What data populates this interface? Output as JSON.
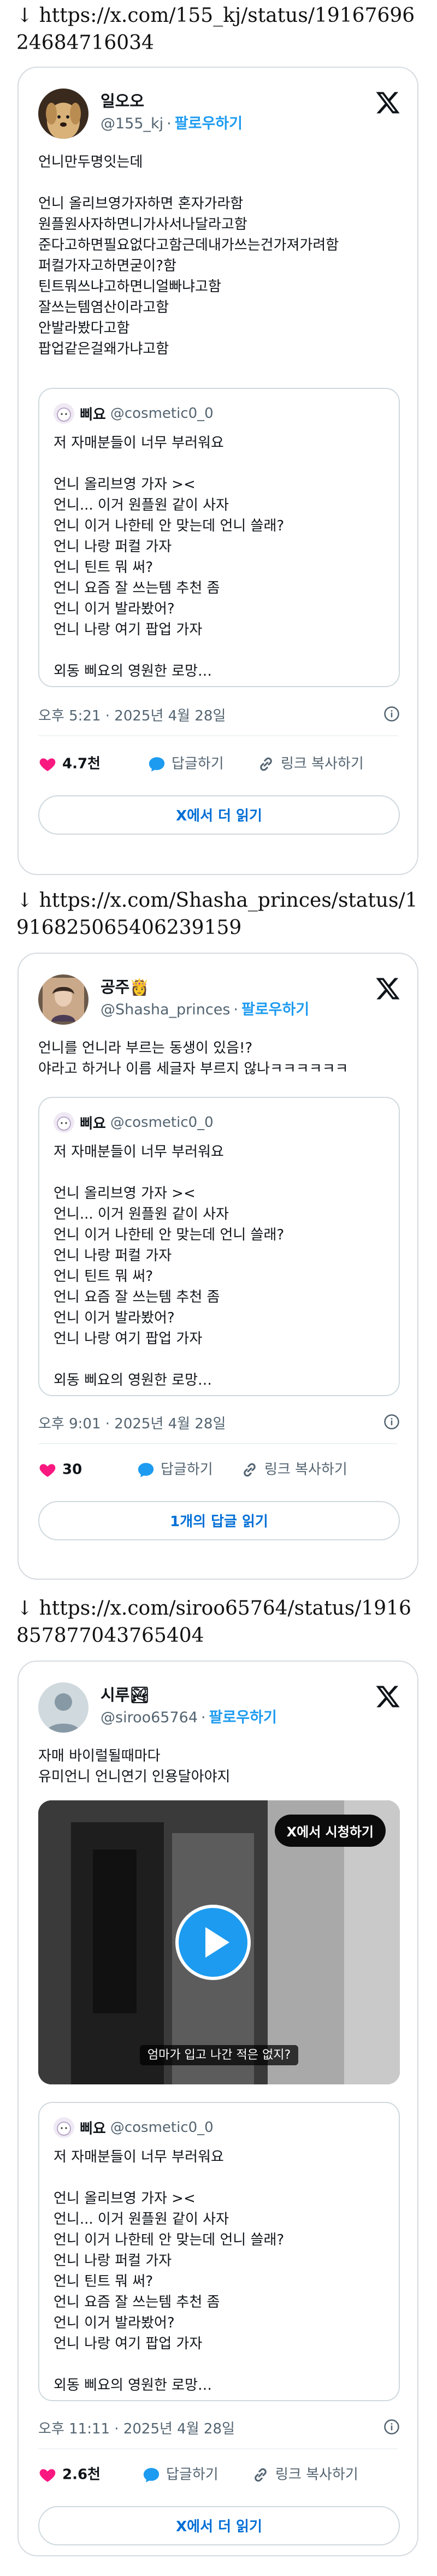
{
  "colors": {
    "link_blue": "#1d9bf0",
    "readmore_blue": "#006fd6",
    "heart": "#f91880",
    "muted": "#536471",
    "border": "#cfd9de"
  },
  "common": {
    "follow_label": "팔로우하기",
    "dot": "·",
    "reply_label": "답글하기",
    "copy_link_label": "링크 복사하기",
    "read_more_label": "X에서 더 읽기",
    "quote": {
      "name": "삐요",
      "handle": "@cosmetic0_0",
      "lines": [
        "저 자매분들이 너무 부러워요",
        "",
        "언니 올리브영 가자 ><",
        "언니... 이거 원플원 같이 사자",
        "언니 이거 나한테 안 맞는데 언니 쓸래?",
        "언니 나랑 퍼컬 가자",
        "언니 틴트 뭐 써?",
        "언니 요즘 잘 쓰는템 추천 좀",
        "언니 이거 발라봤어?",
        "언니 나랑 여기 팝업 가자",
        "",
        "외동 삐요의 영원한 로망…"
      ]
    }
  },
  "posts": [
    {
      "source_url": "↓ https://x.com/155_kj/status/1916769624684716034",
      "name": "일오오",
      "handle": "@155_kj",
      "text": "언니만두명잇는데\n\n언니 올리브영가자하면 혼자가라함\n원플원사자하면니가사서나달라고함\n준다고하면필요없다고함근데내가쓰는건가져가려함\n퍼컬가자고하면굳이?함\n틴트뭐쓰냐고하면니얼빠냐고함\n잘쓰는템염산이라고함\n안발라봤다고함\n팝업같은걸왜가냐고함",
      "time": "오후 5:21 · 2025년 4월 28일",
      "likes": "4.7천",
      "cta": "X에서 더 읽기"
    },
    {
      "source_url": "↓ https://x.com/Shasha_princes/status/1916825065406239159",
      "name": "공주👸",
      "handle": "@Shasha_princes",
      "text": "언니를 언니라 부르는 동생이 있음!?\n야라고 하거나 이름 세글자 부르지 않나ㅋㅋㅋㅋㅋㅋ",
      "time": "오후 9:01 · 2025년 4월 28일",
      "likes": "30",
      "cta": "1개의 답글 읽기"
    },
    {
      "source_url": "↓ https://x.com/siroo65764/status/1916857877043765404",
      "name": "시루🏞",
      "handle": "@siroo65764",
      "text": "자매 바이럴될때마다\n유미언니 언니연기 인용달아야지",
      "video": {
        "watch_label": "X에서 시청하기",
        "caption": "엄마가 입고 나간 적은 없지?"
      },
      "time": "오후 11:11 · 2025년 4월 28일",
      "likes": "2.6천",
      "cta": "X에서 더 읽기"
    }
  ]
}
